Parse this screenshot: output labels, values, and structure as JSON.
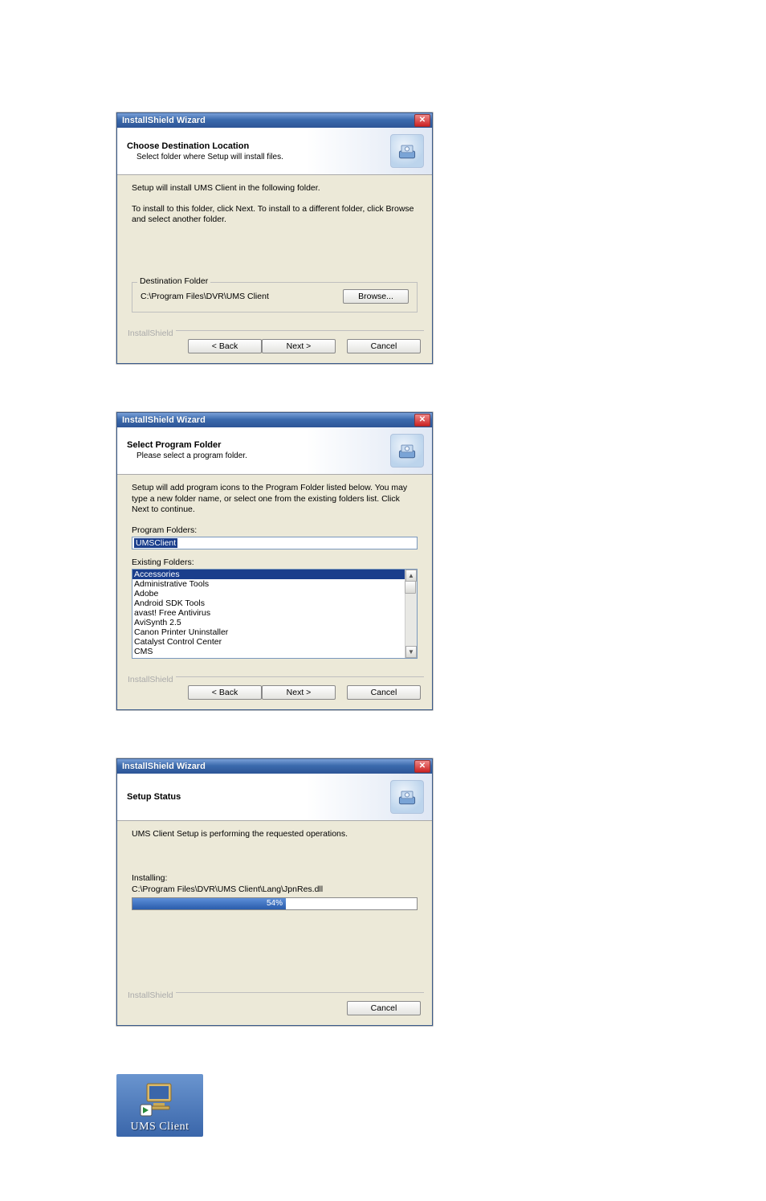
{
  "dialog1": {
    "title": "InstallShield Wizard",
    "header_title": "Choose Destination Location",
    "header_sub": "Select folder where Setup will install files.",
    "line1": "Setup will install UMS Client in the following folder.",
    "line2": "To install to this folder, click Next. To install to a different folder, click Browse and select another folder.",
    "dest_legend": "Destination Folder",
    "dest_path": "C:\\Program Files\\DVR\\UMS Client",
    "browse": "Browse...",
    "brand": "InstallShield",
    "back": "< Back",
    "next": "Next >",
    "cancel": "Cancel"
  },
  "dialog2": {
    "title": "InstallShield Wizard",
    "header_title": "Select Program Folder",
    "header_sub": "Please select a program folder.",
    "line1": "Setup will add program icons to the Program Folder listed below.  You may type a new folder name, or select one from the existing folders list.  Click Next to continue.",
    "pf_label": "Program Folders:",
    "pf_value": "UMSClient",
    "ef_label": "Existing Folders:",
    "folders": [
      "Accessories",
      "Administrative Tools",
      "Adobe",
      "Android SDK Tools",
      "avast! Free Antivirus",
      "AviSynth 2.5",
      "Canon Printer Uninstaller",
      "Catalyst Control Center",
      "CMS"
    ],
    "brand": "InstallShield",
    "back": "< Back",
    "next": "Next >",
    "cancel": "Cancel"
  },
  "dialog3": {
    "title": "InstallShield Wizard",
    "header_title": "Setup Status",
    "line1": "UMS Client Setup is performing the requested operations.",
    "installing_label": "Installing:",
    "installing_path": "C:\\Program Files\\DVR\\UMS Client\\Lang\\JpnRes.dll",
    "progress_pct": 54,
    "progress_text": "54%",
    "brand": "InstallShield",
    "cancel": "Cancel"
  },
  "desktop": {
    "caption": "UMS Client"
  }
}
